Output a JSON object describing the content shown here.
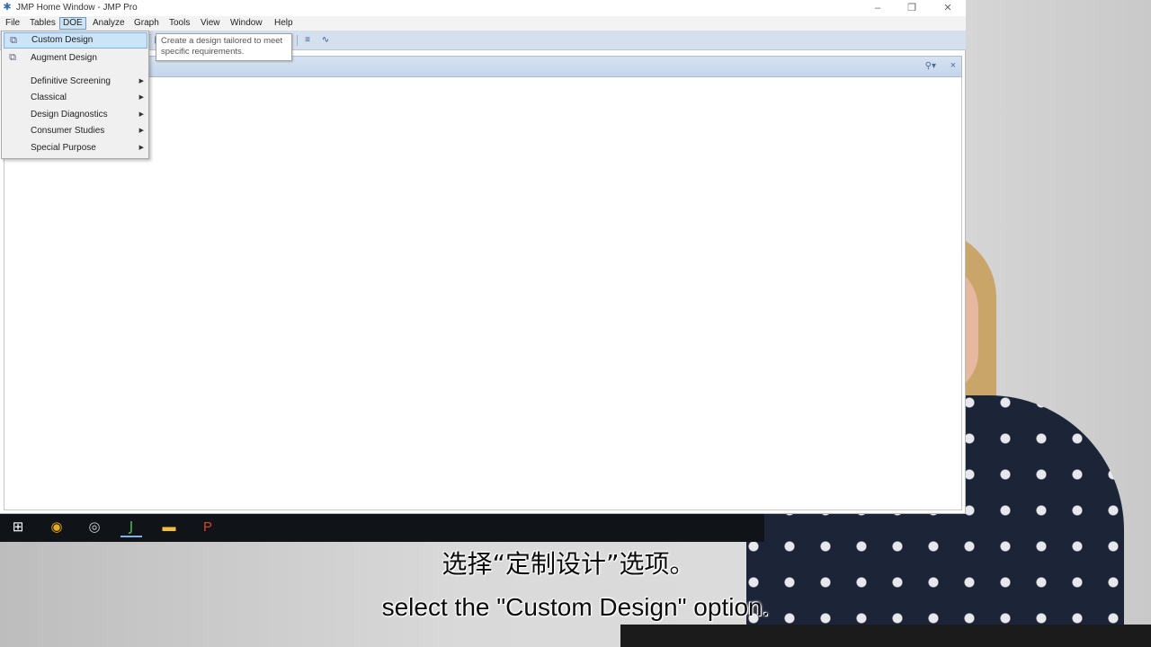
{
  "window": {
    "title": "JMP Home Window - JMP Pro",
    "app_icon": "jmp-app-icon",
    "controls": {
      "minimize": "–",
      "restore": "❐",
      "close": "✕"
    }
  },
  "menubar": {
    "items": [
      {
        "label": "File"
      },
      {
        "label": "Tables"
      },
      {
        "label": "DOE",
        "active": true
      },
      {
        "label": "Analyze"
      },
      {
        "label": "Graph"
      },
      {
        "label": "Tools"
      },
      {
        "label": "View"
      },
      {
        "label": "Window"
      },
      {
        "label": "Help"
      }
    ]
  },
  "doe_menu": {
    "items": [
      {
        "label": "Custom Design",
        "icon": "custom-design-icon",
        "highlighted": true
      },
      {
        "label": "Augment Design",
        "icon": "augment-design-icon"
      },
      {
        "label": "Definitive Screening",
        "submenu": true
      },
      {
        "label": "Classical",
        "submenu": true
      },
      {
        "label": "Design Diagnostics",
        "submenu": true
      },
      {
        "label": "Consumer Studies",
        "submenu": true
      },
      {
        "label": "Special Purpose",
        "submenu": true
      }
    ],
    "submenu_arrow": "▶"
  },
  "tooltip": {
    "line1": "Create a design tailored to meet",
    "line2": "specific requirements."
  },
  "toolbar": {
    "icons": [
      "window-icon",
      "chart-icon",
      "curve-icon"
    ]
  },
  "panel": {
    "pin_icon": "⚲▾",
    "close_icon": "×"
  },
  "taskbar": {
    "apps": [
      {
        "name": "windows-start-icon",
        "glyph": "⊞",
        "color": "#ffffff"
      },
      {
        "name": "chrome-icon",
        "glyph": "◉",
        "color": "#e8a91d"
      },
      {
        "name": "obs-icon",
        "glyph": "◎",
        "color": "#d0d0d0"
      },
      {
        "name": "jmp-taskbar-icon",
        "glyph": "Ϳ",
        "color": "#4fbf5b"
      },
      {
        "name": "file-explorer-icon",
        "glyph": "▬",
        "color": "#f0c040"
      },
      {
        "name": "powerpoint-icon",
        "glyph": "P",
        "color": "#d24726"
      }
    ]
  },
  "subtitles": {
    "chinese": "选择“定制设计”选项。",
    "english": "select the \"Custom Design\" option."
  }
}
